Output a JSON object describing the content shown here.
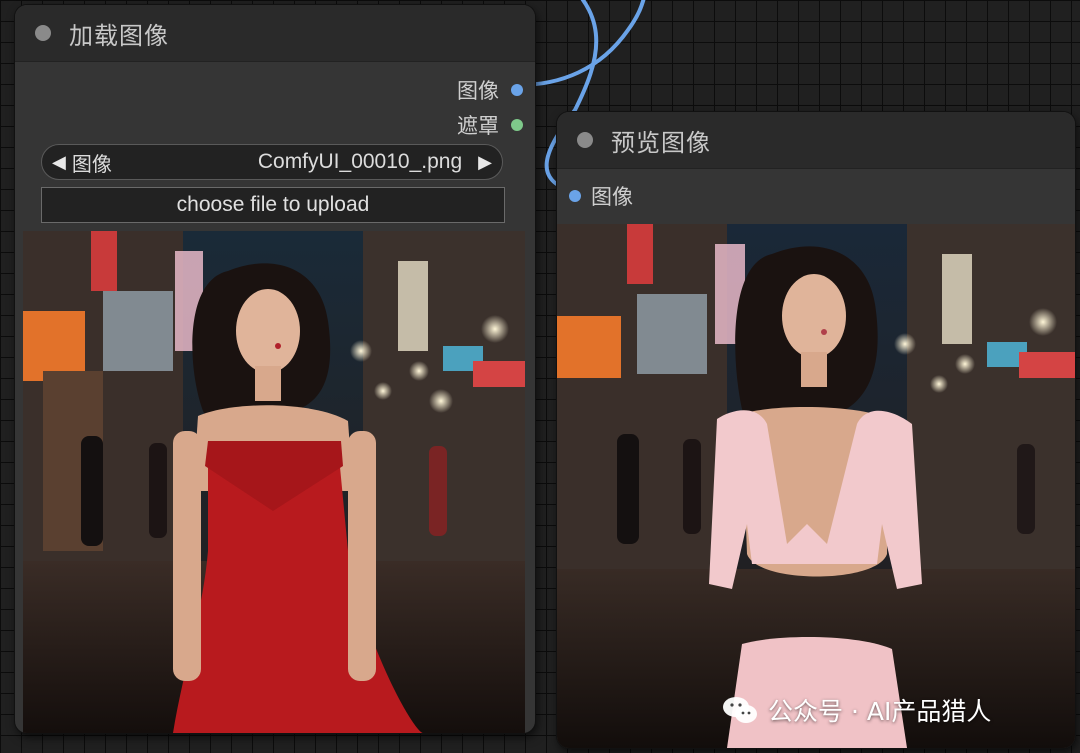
{
  "load_node": {
    "title": "加载图像",
    "outputs": [
      "图像",
      "遮罩"
    ],
    "widget": {
      "name": "图像",
      "value": "ComfyUI_00010_.png"
    },
    "upload_label": "choose file to upload"
  },
  "preview_node": {
    "title": "预览图像",
    "inputs": [
      "图像"
    ]
  },
  "watermark": {
    "text": "公众号 · AI产品猎人"
  },
  "colors": {
    "image_link": "#6aa3e8",
    "mask_link": "#7ec98a",
    "node_bg": "#353535",
    "node_header": "#2a2a2a",
    "canvas_bg": "#202020"
  },
  "icons": {
    "combo_prev": "left-triangle",
    "combo_next": "right-triangle",
    "watermark": "wechat-icon"
  }
}
